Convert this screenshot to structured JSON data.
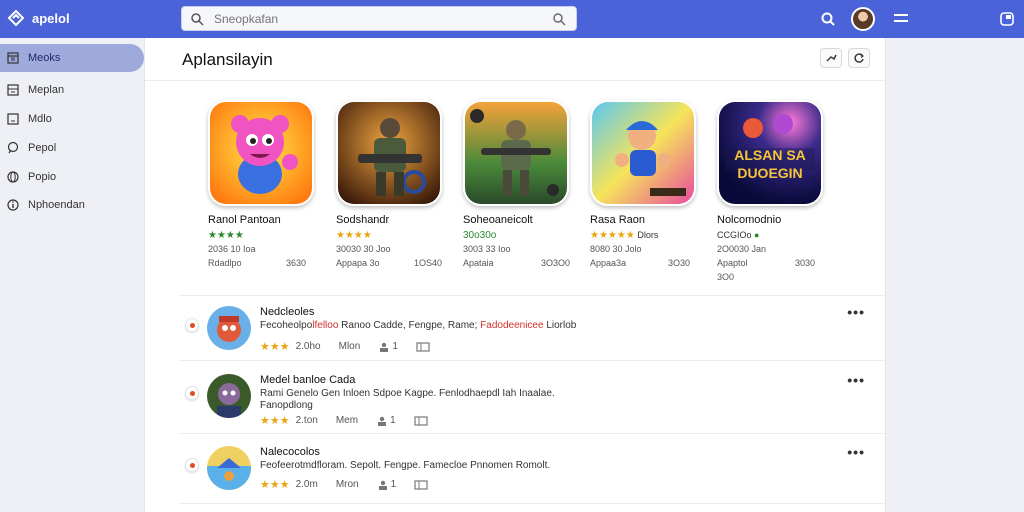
{
  "app": {
    "brand": "apelol"
  },
  "search": {
    "placeholder": "Sneopkafan"
  },
  "sidebar": {
    "items": [
      {
        "label": "Meoks",
        "icon": "calendar-icon",
        "active": true
      },
      {
        "label": "Meplan",
        "icon": "grid-icon"
      },
      {
        "label": "Mdlo",
        "icon": "box-icon"
      },
      {
        "label": "Pepol",
        "icon": "chat-icon"
      },
      {
        "label": "Popio",
        "icon": "globe-icon"
      },
      {
        "label": "Nphoendan",
        "icon": "info-icon"
      }
    ]
  },
  "main": {
    "title": "Aplansilayin",
    "cards": [
      {
        "name": "Ranol Pantoan",
        "rating": "★★★★",
        "rating_extra": "",
        "line1": "2036 10 Ioa",
        "line2_left": "Rdadlpo",
        "line2_right": "3630"
      },
      {
        "name": "Sodshandr",
        "rating": "★★★★",
        "rating_extra": "",
        "line1": "30030 30 Joo",
        "line2_left": "Appapa 3o",
        "line2_right": "1OS40"
      },
      {
        "name": "Soheoaneicolt",
        "rating": "30o30o",
        "rating_extra": "",
        "line1": "3003 33 Ioo",
        "line2_left": "Apataia",
        "line2_right": "3O3O0"
      },
      {
        "name": "Rasa Raon",
        "rating": "★★★★★",
        "rating_extra": "Dlors",
        "line1": "8080 30 Jolo",
        "line2_left": "Appaa3a",
        "line2_right": "3O30"
      },
      {
        "name": "Nolcomodnio",
        "rating": "CCGIOo",
        "rating_extra": "●",
        "line1": "2O0030 Jan",
        "line2_left": "Apaptol",
        "line2_right": "3030",
        "line3": "3O0"
      }
    ],
    "list": [
      {
        "title": "Nedcleoles",
        "desc_parts": [
          "Fecoheolpo",
          "lfelloo",
          " Ranoo Cadde, Fengpe, Rame; ",
          "Fadodeenicee",
          " Liorlob"
        ],
        "desc_red": [
          false,
          true,
          false,
          true,
          false
        ],
        "desc2": "",
        "stars": "★★★",
        "m1": "2.0ho",
        "m2": "Mlon",
        "m3": "1",
        "m4": ""
      },
      {
        "title": "Medel banloe Cada",
        "desc_parts": [
          "Rami Genelo Gen Inloen Sdpoe Kagpe. Fenlodhaepdl Iah Inaalae."
        ],
        "desc_red": [
          false
        ],
        "desc2": "Fanopdlong",
        "stars": "★★★",
        "m1": "2.ton",
        "m2": "Mem",
        "m3": "1",
        "m4": ""
      },
      {
        "title": "Nalecocolos",
        "desc_parts": [
          "Feofeerotmdfloram. Sepolt. Fengpe. Famecloe Pnnomen Romolt."
        ],
        "desc_red": [
          false
        ],
        "desc2": "",
        "stars": "★★★",
        "m1": "2.0m",
        "m2": "Mron",
        "m3": "1",
        "m4": ""
      }
    ]
  }
}
